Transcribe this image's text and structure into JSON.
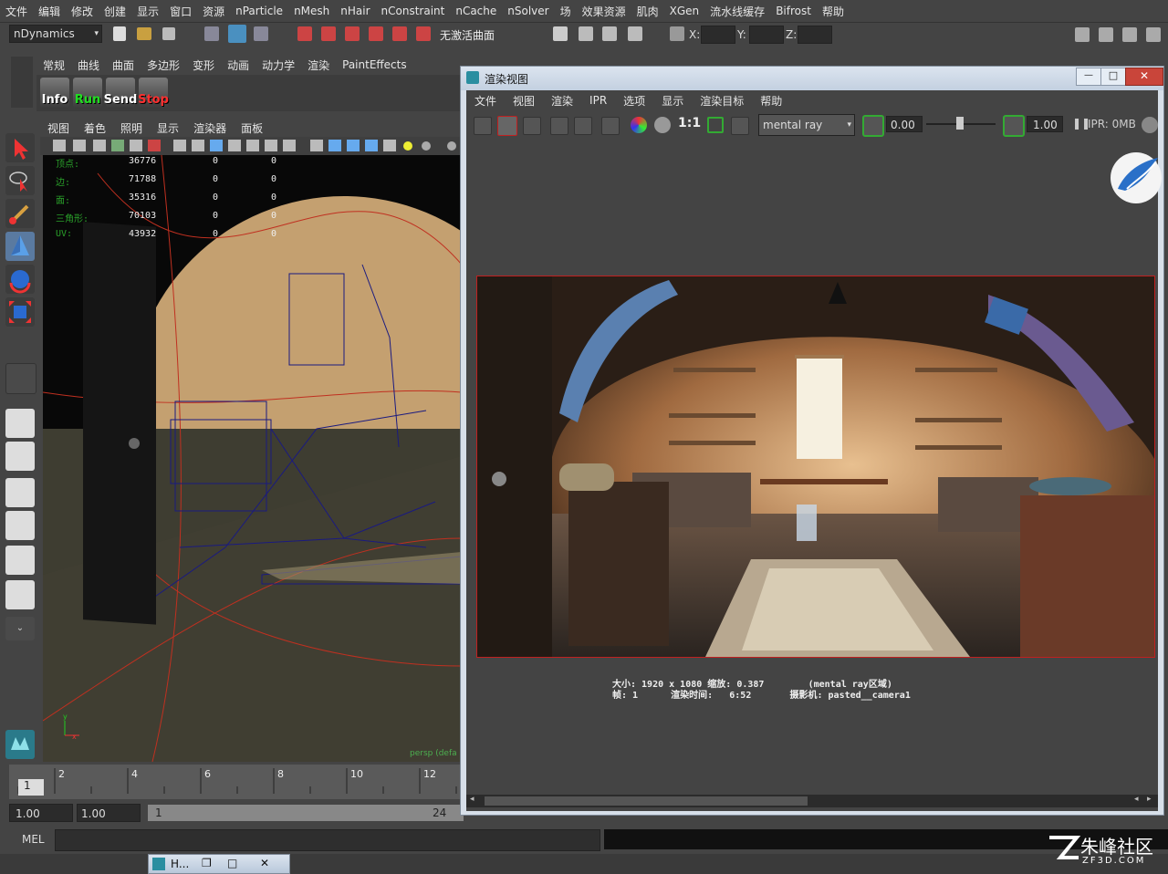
{
  "menubar": [
    "文件",
    "编辑",
    "修改",
    "创建",
    "显示",
    "窗口",
    "资源",
    "nParticle",
    "nMesh",
    "nHair",
    "nConstraint",
    "nCache",
    "nSolver",
    "场",
    "效果资源",
    "肌肉",
    "XGen",
    "流水线缓存",
    "Bifrost",
    "帮助"
  ],
  "status": {
    "menuset": "nDynamics",
    "live_surface": "无激活曲面",
    "x_label": "X:",
    "y_label": "Y:",
    "z_label": "Z:"
  },
  "shelf": {
    "tabs": [
      "常规",
      "曲线",
      "曲面",
      "多边形",
      "变形",
      "动画",
      "动力学",
      "渲染",
      "PaintEffects"
    ],
    "buttons": [
      {
        "label": "Info",
        "color": "#ffffff"
      },
      {
        "label": "Run",
        "color": "#22dd22"
      },
      {
        "label": "Send",
        "color": "#ffffff"
      },
      {
        "label": "Stop",
        "color": "#ff3030"
      }
    ]
  },
  "viewport": {
    "menu": [
      "视图",
      "着色",
      "照明",
      "显示",
      "渲染器",
      "面板"
    ],
    "stats": [
      {
        "label": "顶点:",
        "v1": "36776",
        "v2": "0",
        "v3": "0"
      },
      {
        "label": "边:",
        "v1": "71788",
        "v2": "0",
        "v3": "0"
      },
      {
        "label": "面:",
        "v1": "35316",
        "v2": "0",
        "v3": "0"
      },
      {
        "label": "三角形:",
        "v1": "70103",
        "v2": "0",
        "v3": "0"
      },
      {
        "label": "UV:",
        "v1": "43932",
        "v2": "0",
        "v3": "0"
      }
    ],
    "camera_label": "persp (defa"
  },
  "timeline": {
    "ticks": [
      "2",
      "4",
      "6",
      "8",
      "10",
      "12"
    ],
    "current": "1"
  },
  "range": {
    "start": "1.00",
    "playback_start": "1.00",
    "frame": "1",
    "end_frame": "24"
  },
  "command": {
    "label": "MEL"
  },
  "taskbar": {
    "item": "H..."
  },
  "render_view": {
    "title": "渲染视图",
    "menu": [
      "文件",
      "视图",
      "渲染",
      "IPR",
      "选项",
      "显示",
      "渲染目标",
      "帮助"
    ],
    "ratio": "1:1",
    "renderer": "mental ray",
    "exposure": "0.00",
    "gamma": "1.00",
    "ipr": "IPR: 0MB",
    "info_line1": "大小: 1920 x 1080 缩放: 0.387        (mental ray区域)",
    "info_line2": "帧: 1      渲染时间:   6:52       摄影机: pasted__camera1"
  },
  "watermark": {
    "name": "朱峰社区",
    "url": "ZF3D.COM"
  }
}
